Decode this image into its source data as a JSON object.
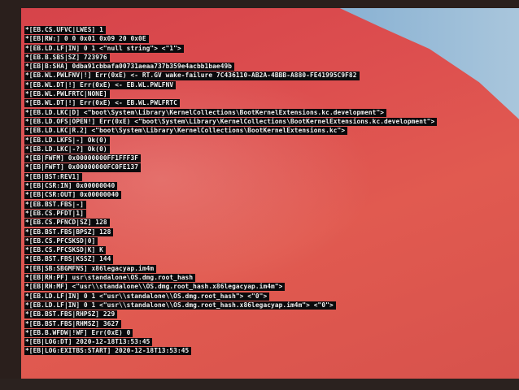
{
  "log_lines": [
    "*[EB.CS.UFVC|LWES] 1",
    "*[EB|RW:] 0 0 0x01 0x09 20 0x0E",
    "*[EB.LD.LF|IN] 0 1 <\"null string\"> <\"1\">",
    "*[EB.B.SBS|SZ] 723976",
    "*[EB|B:SHA] 0dba91cbbafa00731aeaa737b359e4acbb1bae49b",
    "*[EB.WL.PWLFNV|!] Err(0xE) <- RT.GV wake-failure 7C436110-AB2A-4BBB-A880-FE41995C9F82",
    "*[EB.WL.DT|!] Err(0xE) <- EB.WL.PWLFNV",
    "*[EB.WL.PWLFRTC|NONE]",
    "*[EB.WL.DT|!] Err(0xE) <- EB.WL.PWLFRTC",
    "*[EB.LD.LKC|D] <\"boot\\System\\Library\\KernelCollections\\BootKernelExtensions.kc.development\">",
    "*[EB.LD.OFS|OPEN!] Err(0xE) <\"boot\\System\\Library\\KernelCollections\\BootKernelExtensions.kc.development\">",
    "*[EB.LD.LKC|R.2] <\"boot\\System\\Library\\KernelCollections\\BootKernelExtensions.kc\">",
    "*[EB.LD.LKFS|-] Ok(0)",
    "*[EB.LD.LKC|-?] Ok(0)",
    "*[EB|FWFM] 0x00000000FF1FFF3F",
    "*[EB|FWFT] 0x00000000FC0FE137",
    "*[EB|BST:REV1]",
    "*[EB|CSR:IN] 0x00000040",
    "*[EB|CSR:OUT] 0x00000040",
    "*[EB.BST.FBS|-]",
    "*[EB.CS.PFDT|1]",
    "*[EB.CS.PFNCD|SZ] 128",
    "*[EB.BST.FBS|BPSZ] 128",
    "*[EB.CS.PFCSKSD|0]",
    "*[EB.CS.PFCSKSD|K] K",
    "*[EB.BST.FBS|KSSZ] 144",
    "*[EB|SB:SBGMFNS] x86legacyap.im4m",
    "*[EB|RH:PF] usr\\standalone\\OS.dmg.root_hash",
    "*[EB|RH:MF] <\"usr\\\\standalone\\\\OS.dmg.root_hash.x86legacyap.im4m\">",
    "*[EB.LD.LF|IN] 0 1 <\"usr\\\\standalone\\\\OS.dmg.root_hash\"> <\"0\">",
    "*[EB.LD.LF|IN] 0 1 <\"usr\\\\standalone\\\\OS.dmg.root_hash.x86legacyap.im4m\"> <\"0\">",
    "*[EB.BST.FBS|RHPSZ] 229",
    "*[EB.BST.FBS|RHMSZ] 3627",
    "*[EB.B.WFDW|!WF] Err(0xE) 0",
    "*[EB|LOG:DT] 2020-12-18T13:53:45",
    "*[EB|LOG:EXITBS:START] 2020-12-18T13:53:45"
  ]
}
